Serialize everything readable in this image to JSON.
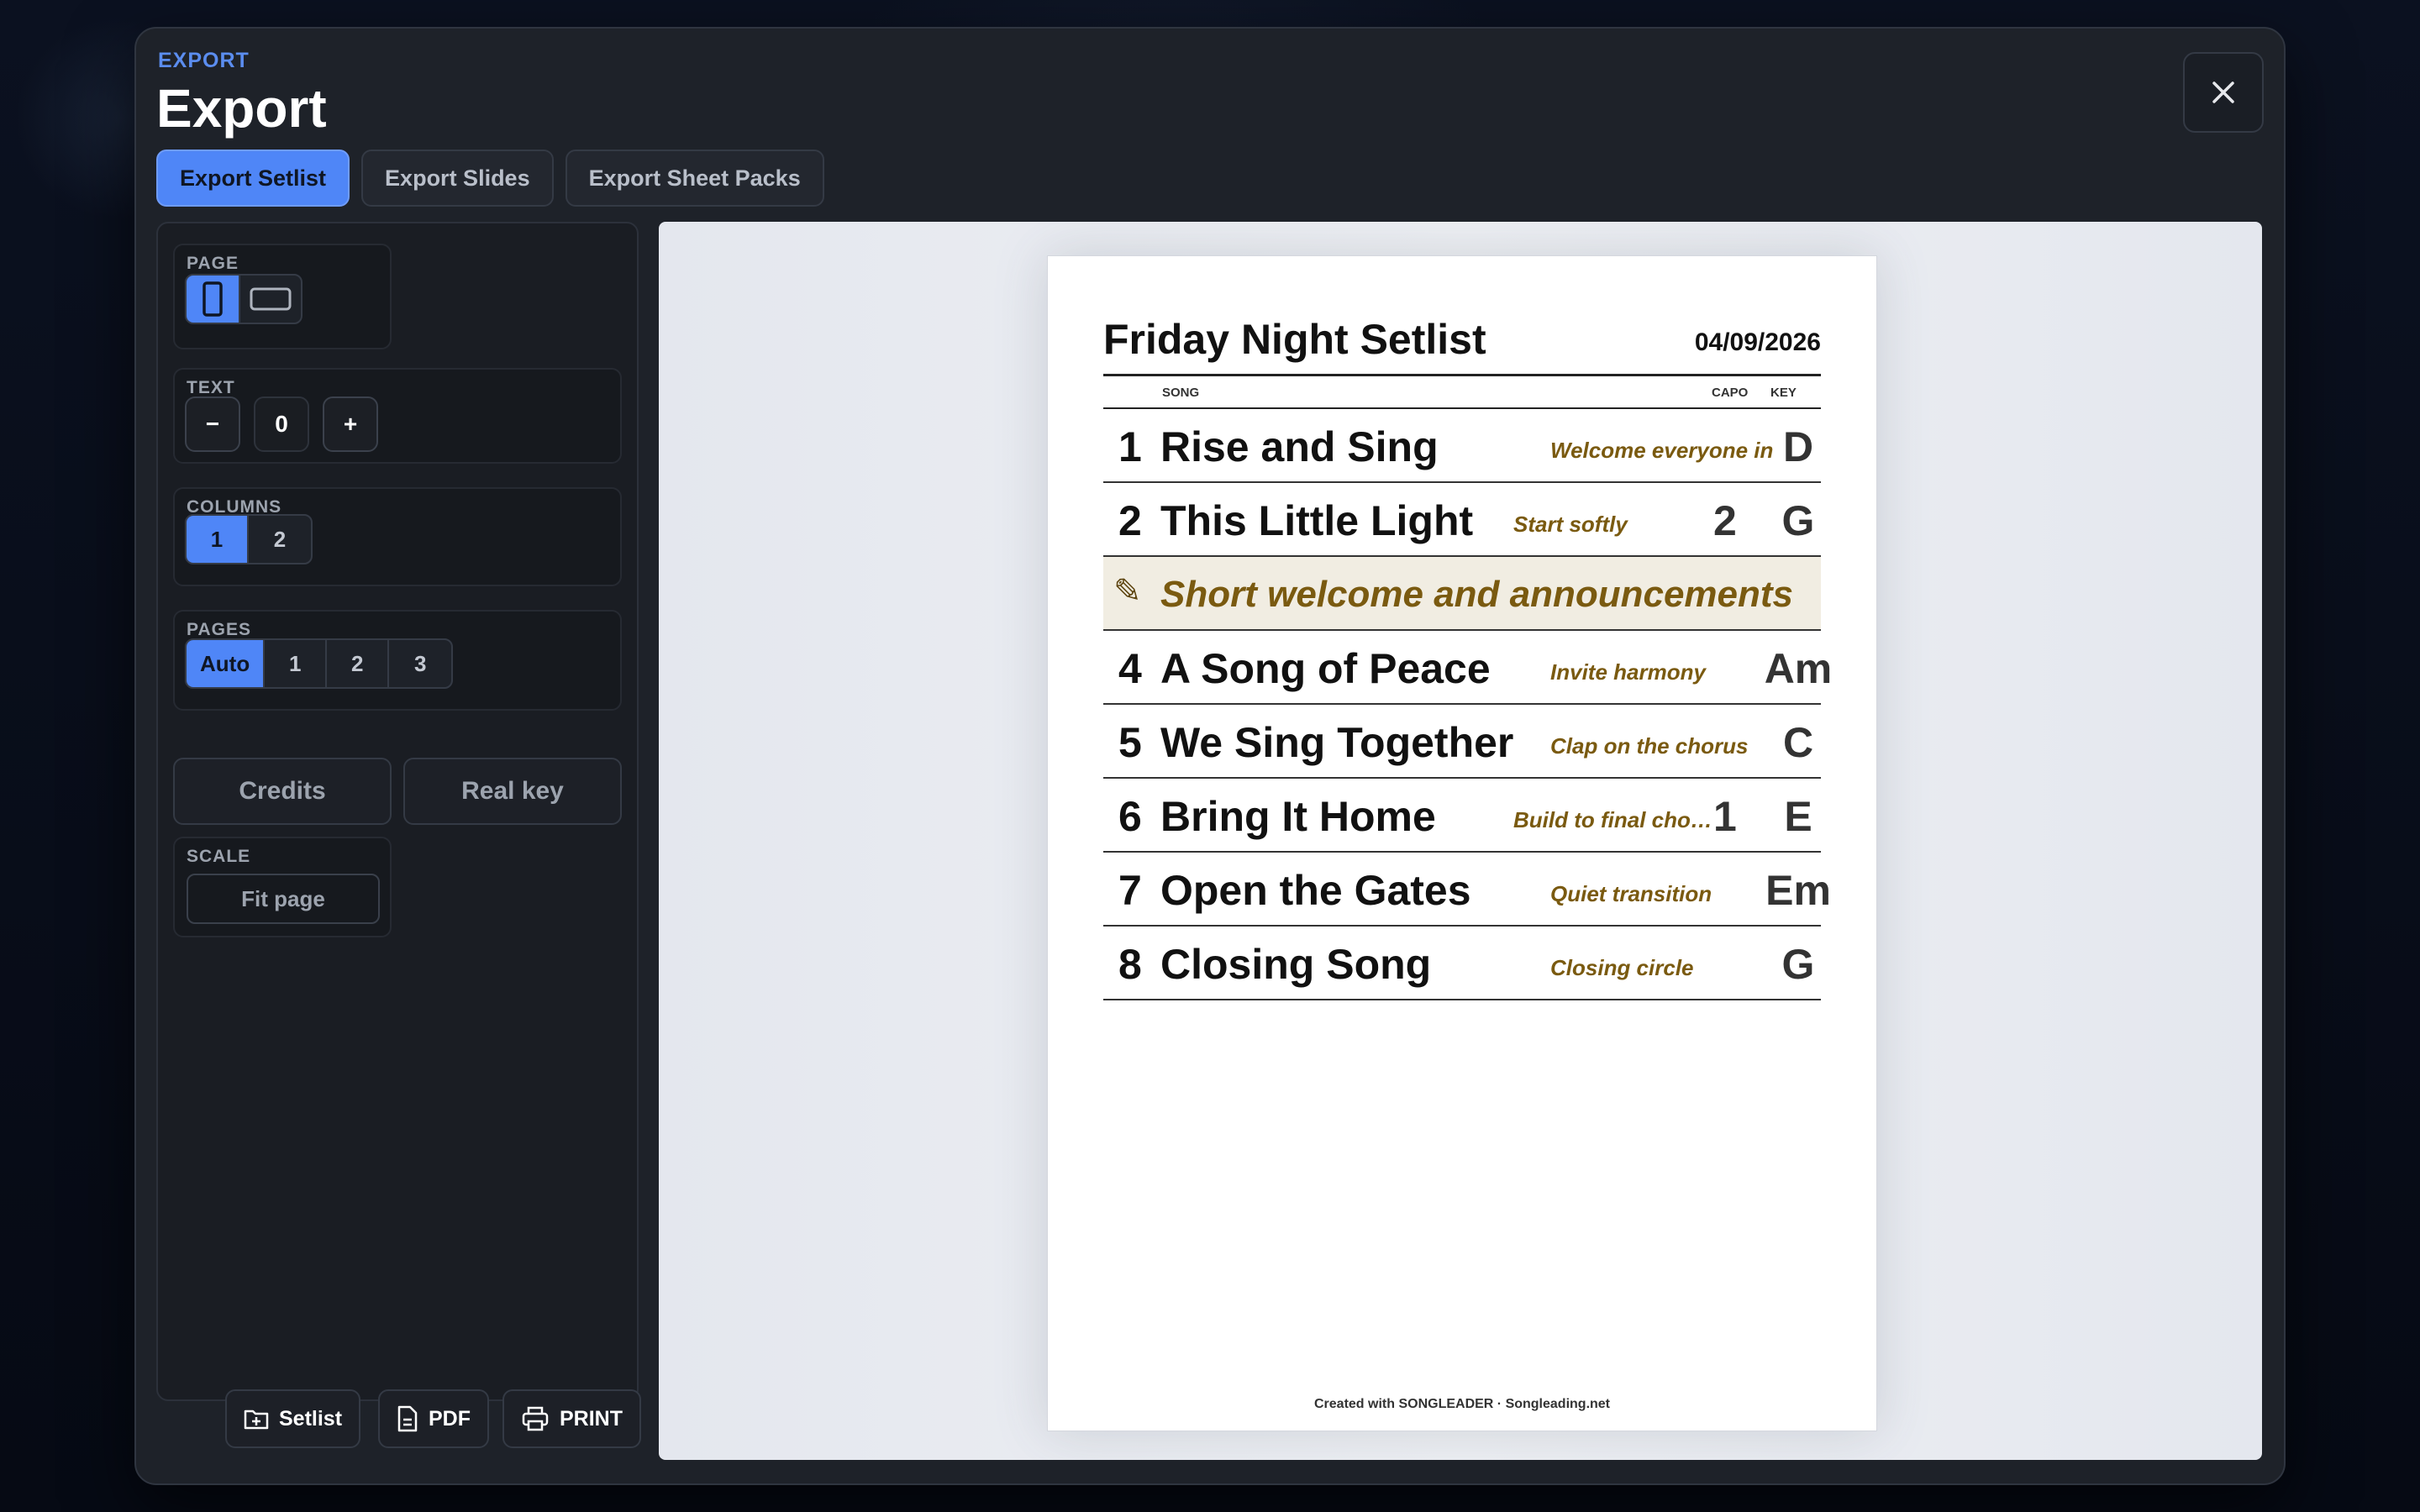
{
  "dialog": {
    "eyebrow": "EXPORT",
    "title": "Export",
    "close_icon": "close-icon",
    "tabs": [
      {
        "label": "Export Setlist",
        "active": true
      },
      {
        "label": "Export Slides",
        "active": false
      },
      {
        "label": "Export Sheet Packs",
        "active": false
      }
    ]
  },
  "sidebar": {
    "page": {
      "label": "PAGE",
      "options": [
        "portrait-icon",
        "landscape-icon"
      ],
      "selected": "portrait"
    },
    "text": {
      "label": "TEXT",
      "decrease": "−",
      "value": "0",
      "increase": "+"
    },
    "columns": {
      "label": "COLUMNS",
      "options": [
        "1",
        "2"
      ],
      "selected": "1"
    },
    "pages": {
      "label": "PAGES",
      "options": [
        "Auto",
        "1",
        "2",
        "3"
      ],
      "selected": "Auto"
    },
    "toggles": {
      "credits": "Credits",
      "real_key": "Real key"
    },
    "scale": {
      "label": "SCALE",
      "button": "Fit page"
    }
  },
  "footer": {
    "setlist": {
      "label": "Setlist",
      "icon": "folder-plus-icon"
    },
    "pdf": {
      "label": "PDF",
      "icon": "document-icon"
    },
    "print": {
      "label": "PRINT",
      "icon": "printer-icon"
    }
  },
  "preview": {
    "title": "Friday Night Setlist",
    "date": "04/09/2026",
    "headers": {
      "song": "SONG",
      "capo": "CAPO",
      "key": "KEY"
    },
    "rows": [
      {
        "num": "1",
        "title": "Rise and Sing",
        "note": "Welcome everyone in",
        "capo": "",
        "key": "D"
      },
      {
        "num": "2",
        "title": "This Little Light",
        "note": "Start softly",
        "capo": "2",
        "key": "G"
      },
      {
        "note_row": "Short welcome and announcements"
      },
      {
        "num": "4",
        "title": "A Song of Peace",
        "note": "Invite harmony",
        "capo": "",
        "key": "Am"
      },
      {
        "num": "5",
        "title": "We Sing Together",
        "note": "Clap on the chorus",
        "capo": "",
        "key": "C"
      },
      {
        "num": "6",
        "title": "Bring It Home",
        "note": "Build to final cho…",
        "capo": "1",
        "key": "E"
      },
      {
        "num": "7",
        "title": "Open the Gates",
        "note": "Quiet transition",
        "capo": "",
        "key": "Em"
      },
      {
        "num": "8",
        "title": "Closing Song",
        "note": "Closing circle",
        "capo": "",
        "key": "G"
      }
    ],
    "footer": "Created with SONGLEADER · Songleading.net"
  },
  "colors": {
    "accent": "#4f86f7",
    "note": "#7a5a10",
    "modal_bg": "#1e2229"
  }
}
